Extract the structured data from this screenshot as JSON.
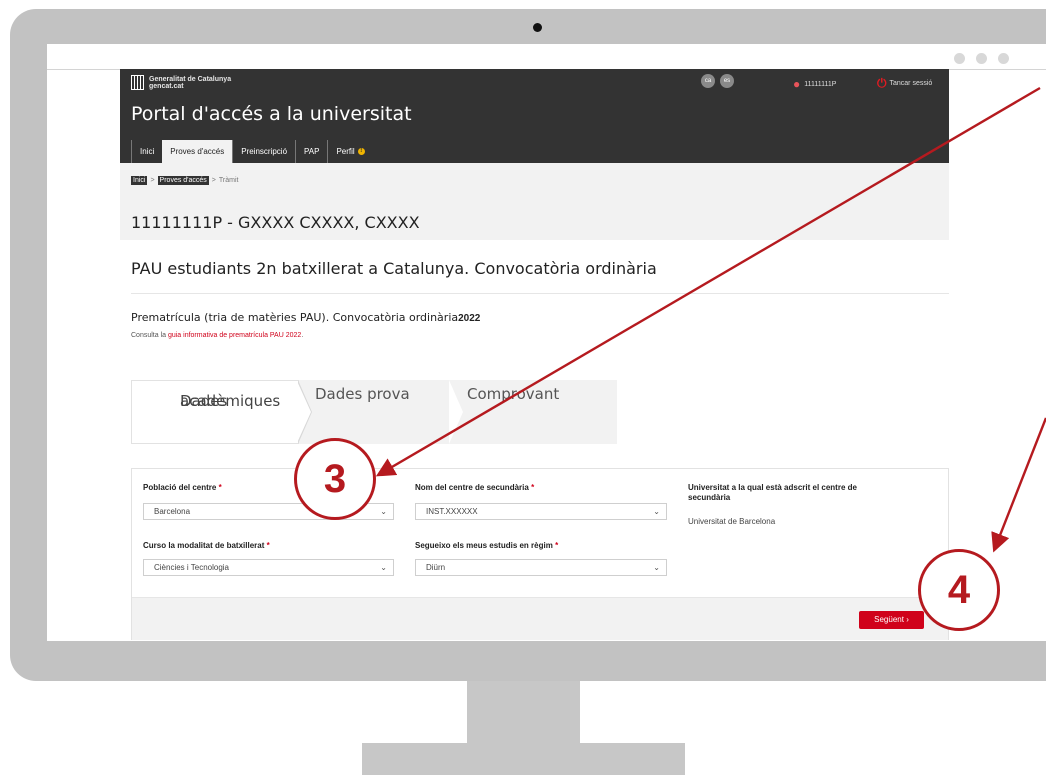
{
  "header": {
    "gov_line1": "Generalitat de Catalunya",
    "gov_line2": "gencat.cat",
    "lang_ca": "ca",
    "lang_es": "es",
    "user_id": "11111111P",
    "logout_label": "Tancar sessió",
    "portal_title": "Portal d'accés a la universitat",
    "tabs": [
      {
        "label": "Inici"
      },
      {
        "label": "Proves d'accés"
      },
      {
        "label": "Preinscripció"
      },
      {
        "label": "PAP"
      },
      {
        "label": "Perfil"
      }
    ],
    "warn_glyph": "!"
  },
  "breadcrumb": {
    "items": [
      "Inici",
      "Proves d'accés",
      "Tràmit"
    ],
    "separator": ">"
  },
  "identity": "11111111P - GXXXX CXXXX, CXXXX",
  "exam_title": "PAU estudiants 2n batxillerat a Catalunya. Convocatòria ordinària",
  "prereg": {
    "title": "Prematrícula (tria de matèries PAU). Convocatòria ordinària",
    "year": "2022",
    "guide_prefix": "Consulta la ",
    "guide_link": "guia informativa de prematrícula PAU",
    "guide_year": "2022",
    "guide_suffix": "."
  },
  "steps": {
    "step1_line1": "Dades",
    "step1_line2": "acadèmiques",
    "step2": "Dades prova",
    "step3": "Comprovant"
  },
  "form": {
    "required_mark": "*",
    "city_label": "Població del centre",
    "city_value": "Barcelona",
    "school_label": "Nom del centre de secundària",
    "school_value": "INST.XXXXXX",
    "univ_label_line1": "Universitat a la qual està adscrit el centre de",
    "univ_label_line2": "secundària",
    "univ_value": "Universitat de Barcelona",
    "modality_label": "Curso la modalitat de batxillerat",
    "modality_value": "Ciències i Tecnologia",
    "regime_label": "Segueixo els meus estudis en règim",
    "regime_value": "Diürn",
    "next_button": "Següent",
    "next_glyph": "›",
    "caret_glyph": "⌄"
  },
  "annotations": {
    "step3_number": "3",
    "step4_number": "4",
    "color": "#b51a1f"
  },
  "colors": {
    "topbar": "#333333",
    "accent_red": "#d0021b",
    "bezel": "#c2c2c2"
  }
}
